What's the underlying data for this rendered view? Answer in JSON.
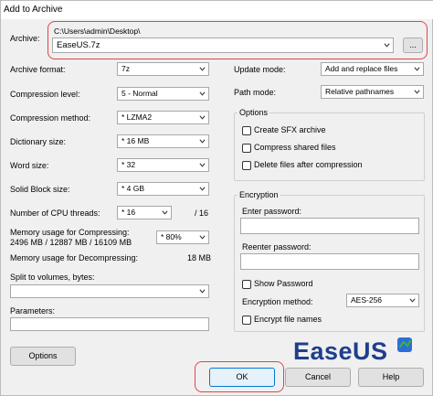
{
  "window": {
    "title": "Add to Archive"
  },
  "archive": {
    "label": "Archive:",
    "path": "C:\\Users\\admin\\Desktop\\",
    "filename": "EaseUS.7z",
    "browse_label": "..."
  },
  "left": {
    "archive_format": {
      "label": "Archive format:",
      "value": "7z"
    },
    "compression_level": {
      "label": "Compression level:",
      "value": "5 - Normal"
    },
    "compression_method": {
      "label": "Compression method:",
      "value": "* LZMA2"
    },
    "dictionary_size": {
      "label": "Dictionary size:",
      "value": "* 16 MB"
    },
    "word_size": {
      "label": "Word size:",
      "value": "* 32"
    },
    "solid_block_size": {
      "label": "Solid Block size:",
      "value": "* 4 GB"
    },
    "cpu_threads": {
      "label": "Number of CPU threads:",
      "value": "* 16",
      "max": "/ 16"
    },
    "memory_compress": {
      "label": "Memory usage for Compressing:",
      "detail": "2496 MB / 12887 MB / 16109 MB",
      "value": "* 80%"
    },
    "memory_decompress": {
      "label": "Memory usage for Decompressing:",
      "value": "18 MB"
    },
    "split": {
      "label": "Split to volumes, bytes:",
      "value": ""
    },
    "parameters": {
      "label": "Parameters:",
      "value": ""
    },
    "options_button": "Options"
  },
  "right": {
    "update_mode": {
      "label": "Update mode:",
      "value": "Add and replace files"
    },
    "path_mode": {
      "label": "Path mode:",
      "value": "Relative pathnames"
    },
    "options_group": {
      "title": "Options",
      "items": [
        "Create SFX archive",
        "Compress shared files",
        "Delete files after compression"
      ]
    },
    "encryption_group": {
      "title": "Encryption",
      "enter_password": "Enter password:",
      "reenter_password": "Reenter password:",
      "show_password": "Show Password",
      "method_label": "Encryption method:",
      "method_value": "AES-256",
      "encrypt_names": "Encrypt file names"
    }
  },
  "footer": {
    "brand": "EaseUS",
    "ok": "OK",
    "cancel": "Cancel",
    "help": "Help"
  },
  "colors": {
    "brand": "#1f3e8c",
    "highlight": "#e0434b",
    "brand_logo_blue": "#2b6fd6",
    "brand_logo_green": "#3fae49"
  }
}
